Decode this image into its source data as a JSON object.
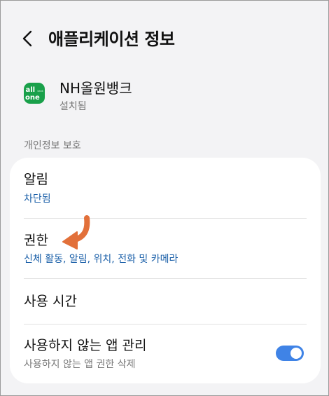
{
  "header": {
    "title": "애플리케이션 정보"
  },
  "app": {
    "name": "NH올원뱅크",
    "status": "설치됨",
    "icon_line1": "all",
    "icon_line2": "one",
    "icon_badge": "bank"
  },
  "section": {
    "label": "개인정보 보호"
  },
  "items": [
    {
      "title": "알림",
      "subtitle": "차단됨"
    },
    {
      "title": "권한",
      "subtitle": "신체 활동, 알림, 위치, 전화 및 카메라"
    },
    {
      "title": "사용 시간"
    },
    {
      "title": "사용하지 않는 앱 관리",
      "subtitle": "사용하지 않는 앱 권한 삭제",
      "toggle_on": true
    }
  ],
  "colors": {
    "accent_blue": "#1a5fa8",
    "toggle_on": "#3f83e6",
    "app_icon_green": "#19a04a",
    "annotation_arrow": "#e2703a"
  }
}
